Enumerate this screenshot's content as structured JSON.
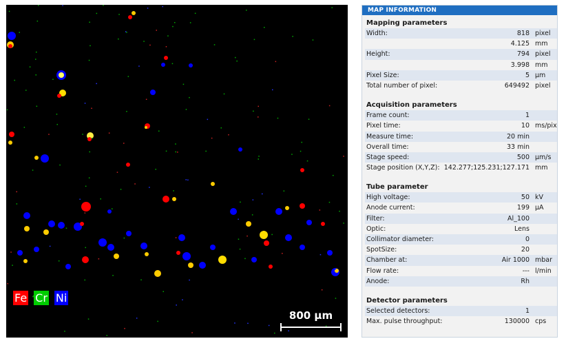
{
  "map": {
    "legend": [
      {
        "label": "Fe",
        "color": "#ff0000"
      },
      {
        "label": "Cr",
        "color": "#00cc00"
      },
      {
        "label": "Ni",
        "color": "#0000ff"
      }
    ],
    "scale_label": "800 µm"
  },
  "info": {
    "title": "MAP INFORMATION",
    "sections": [
      {
        "title": "Mapping parameters",
        "rows": [
          {
            "key": "Width:",
            "value": "818",
            "unit": "pixel",
            "shade": true
          },
          {
            "key": "",
            "value": "4.125",
            "unit": "mm",
            "shade": false
          },
          {
            "key": "Height:",
            "value": "794",
            "unit": "pixel",
            "shade": true
          },
          {
            "key": "",
            "value": "3.998",
            "unit": "mm",
            "shade": false
          },
          {
            "key": "Pixel Size:",
            "value": "5",
            "unit": "µm",
            "shade": true
          },
          {
            "key": "Total number of pixel:",
            "value": "649492",
            "unit": "pixel",
            "shade": false
          }
        ]
      },
      {
        "title": "Acquisition parameters",
        "rows": [
          {
            "key": "Frame count:",
            "value": "1",
            "unit": "",
            "shade": true
          },
          {
            "key": "Pixel time:",
            "value": "10",
            "unit": "ms/pixe",
            "shade": false
          },
          {
            "key": "Measure time:",
            "value": "20 min",
            "unit": "",
            "shade": true
          },
          {
            "key": "Overall time:",
            "value": "33 min",
            "unit": "",
            "shade": false
          },
          {
            "key": "Stage speed:",
            "value": "500",
            "unit": "µm/s",
            "shade": true
          },
          {
            "key": "Stage position (X,Y,Z):",
            "value": "142.277;125.231;127.171",
            "unit": "mm",
            "shade": false
          }
        ]
      },
      {
        "title": "Tube parameter",
        "rows": [
          {
            "key": "High voltage:",
            "value": "50",
            "unit": "kV",
            "shade": true
          },
          {
            "key": "Anode current:",
            "value": "199",
            "unit": "µA",
            "shade": false
          },
          {
            "key": "Filter:",
            "value": "Al_100",
            "unit": "",
            "shade": true
          },
          {
            "key": "Optic:",
            "value": "Lens",
            "unit": "",
            "shade": false
          },
          {
            "key": "Collimator diameter:",
            "value": "0",
            "unit": "",
            "shade": true
          },
          {
            "key": "SpotSize:",
            "value": "20",
            "unit": "",
            "shade": false
          },
          {
            "key": "Chamber at:",
            "value": "Air 1000",
            "unit": "mbar",
            "shade": true
          },
          {
            "key": "Flow rate:",
            "value": "---",
            "unit": "l/min",
            "shade": false
          },
          {
            "key": "Anode:",
            "value": "Rh",
            "unit": "",
            "shade": true
          }
        ]
      },
      {
        "title": "Detector parameters",
        "rows": [
          {
            "key": "Selected detectors:",
            "value": "1",
            "unit": "",
            "shade": true
          },
          {
            "key": "Max. pulse throughput:",
            "value": "130000",
            "unit": "cps",
            "shade": false
          }
        ]
      }
    ]
  }
}
